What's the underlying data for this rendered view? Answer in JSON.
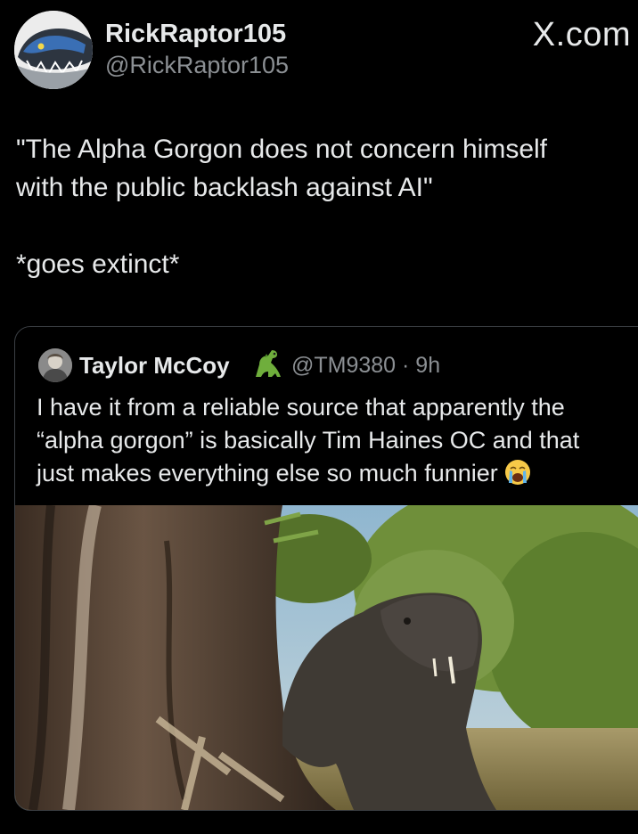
{
  "author": {
    "display_name": "RickRaptor105",
    "handle": "@RickRaptor105",
    "avatar_icon": "blue-raptor-avatar-icon"
  },
  "watermark": "X.com",
  "tweet": {
    "lines": [
      "\"The Alpha Gorgon does not concern himself",
      "with the public backlash against AI\"",
      "*goes extinct*"
    ]
  },
  "quoted_tweet": {
    "display_name": "Taylor McCoy",
    "name_emoji": "dinosaur-emoji",
    "handle_time": "@TM9380 · 9h",
    "text_lines": [
      "I have it from a reliable source that apparently the",
      "“alpha gorgon” is basically Tim Haines OC and that",
      "just makes everything else so much funnier"
    ],
    "trailing_emoji": "crying-face-emoji",
    "media": {
      "type": "photo",
      "icon": "gorgonopsid-photo"
    }
  },
  "colors": {
    "background": "#000000",
    "text_primary": "#e7e9ea",
    "text_secondary": "#8b8f93",
    "card_border": "#3b3f44"
  }
}
